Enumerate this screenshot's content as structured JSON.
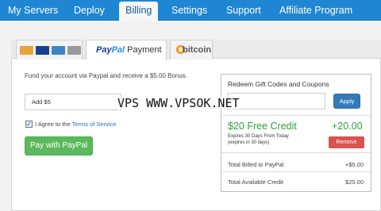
{
  "nav": {
    "items": [
      {
        "label": "My Servers"
      },
      {
        "label": "Deploy"
      },
      {
        "label": "Billing"
      },
      {
        "label": "Settings"
      },
      {
        "label": "Support"
      },
      {
        "label": "Affiliate Program"
      }
    ],
    "active_index": 2
  },
  "tabs": {
    "paypal_label_brand_a": "Pay",
    "paypal_label_brand_b": "Pal",
    "paypal_label_rest": " Payment",
    "bitcoin_label": "bitcoin",
    "cards": [
      "mastercard",
      "visa",
      "amex",
      "card"
    ]
  },
  "paypal": {
    "fund_text": "Fund your account via Paypal and receive a $5.00 Bonus.",
    "amount_value": "Add $5",
    "agree_prefix": "I Agree to the ",
    "agree_link": "Terms of Service",
    "agree_checked": true,
    "pay_button": "Pay with PayPal"
  },
  "redeem": {
    "title": "Redeem Gift Codes and Coupons",
    "apply_label": "Apply",
    "credit_title": "$20 Free Credit",
    "credit_amount": "+20.00",
    "expires_line1": "Expires 30 Days From Today",
    "expires_line2": "(expires in 30 days)",
    "remove_label": "Remove",
    "total_billed_label": "Total Billed to PayPal",
    "total_billed_value": "+$5.00",
    "total_credit_label": "Total Available Credit",
    "total_credit_value": "$25.00"
  },
  "watermark": "VPS WWW.VPSOK.NET",
  "colors": {
    "nav_bg": "#1f86d4",
    "success": "#5cb85c",
    "credit_green": "#2aa33a",
    "danger": "#d9534f",
    "primary": "#337ab7"
  }
}
